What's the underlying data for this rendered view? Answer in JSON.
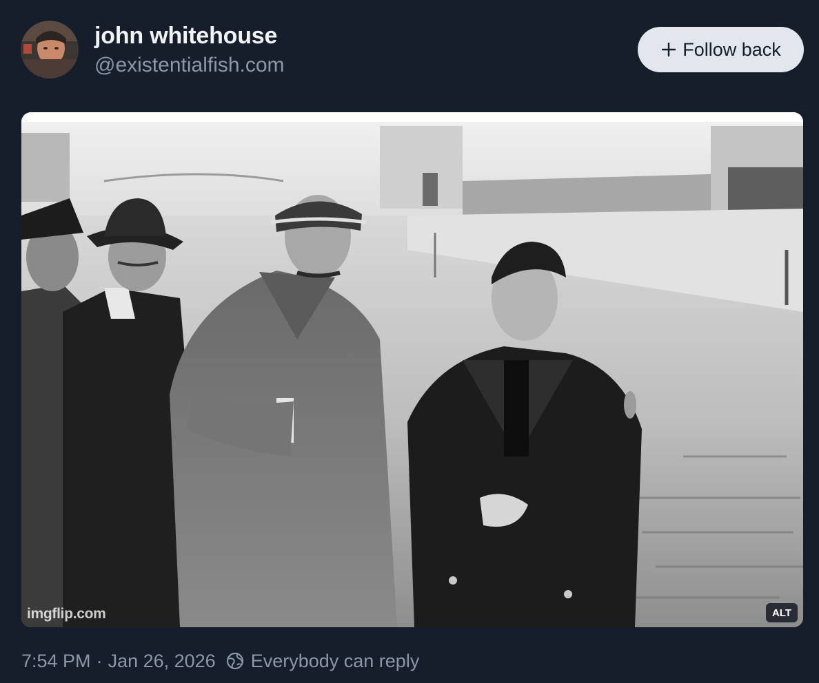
{
  "author": {
    "display_name": "john whitehouse",
    "handle": "@existentialfish.com",
    "avatar_icon": "profile-photo"
  },
  "actions": {
    "follow_label": "Follow back",
    "follow_icon": "plus-icon"
  },
  "media": {
    "watermark": "imgflip.com",
    "alt_badge": "ALT"
  },
  "meta": {
    "time": "7:54 PM",
    "separator": "·",
    "date": "Jan 26, 2026",
    "reply_icon": "globe-icon",
    "reply_setting": "Everybody can reply"
  },
  "colors": {
    "background": "#161e2b",
    "primary_text": "#f1f3f5",
    "secondary_text": "#8b98a9",
    "button_bg": "#e2e7ee"
  }
}
